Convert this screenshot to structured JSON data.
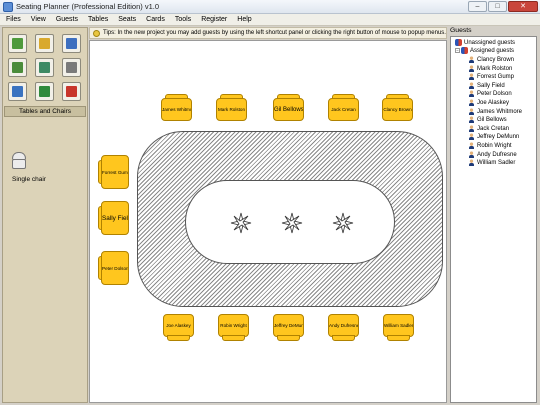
{
  "window": {
    "title": "Seating Planner (Professional Edition) v1.0",
    "minimize": "–",
    "maximize": "□",
    "close": "✕"
  },
  "menu": [
    "Files",
    "View",
    "Guests",
    "Tables",
    "Seats",
    "Cards",
    "Tools",
    "Register",
    "Help"
  ],
  "toolbar": {
    "buttons": [
      {
        "name": "new-project-icon",
        "color": "#4f9a3c"
      },
      {
        "name": "open-folder-icon",
        "color": "#d9a92d"
      },
      {
        "name": "save-icon",
        "color": "#3d6fbf"
      },
      {
        "name": "add-guest-icon",
        "color": "#4b8c3a"
      },
      {
        "name": "image-icon",
        "color": "#3d8a64"
      },
      {
        "name": "print-icon",
        "color": "#7a7a7a"
      },
      {
        "name": "chart-icon",
        "color": "#3a73c0"
      },
      {
        "name": "currency-icon",
        "color": "#2f8a3c"
      },
      {
        "name": "power-icon",
        "color": "#c8352b"
      }
    ]
  },
  "left_panel": {
    "section_title": "Tables and Chairs",
    "item_label": "Single chair"
  },
  "tips": "Tips: In the new project you may add guests by using the left shortcut panel or clicking the right button of mouse to popup menus.",
  "seats": {
    "top": [
      "James Whitmore",
      "Mark Rolston",
      "Gil Bellows",
      "Jack Cretan",
      "Clancy Brown"
    ],
    "left": [
      "Forrest Gump",
      "Sally Field",
      "Peter Dolson"
    ],
    "bottom": [
      "Joe Alaskey",
      "Robin Wright",
      "Jeffrey DeMunn",
      "Andy Dufresne",
      "William Sadler"
    ]
  },
  "guests_panel": {
    "title": "Guests",
    "unassigned": "Unassigned guests",
    "assigned": "Assigned guests",
    "assigned_list": [
      "Clancy Brown",
      "Mark Rolston",
      "Forrest Gump",
      "Sally Field",
      "Peter Dolson",
      "Joe Alaskey",
      "James Whitmore",
      "Gil Bellows",
      "Jack Cretan",
      "Jeffrey DeMunn",
      "Robin Wright",
      "Andy Dufresne",
      "William Sadler"
    ]
  }
}
